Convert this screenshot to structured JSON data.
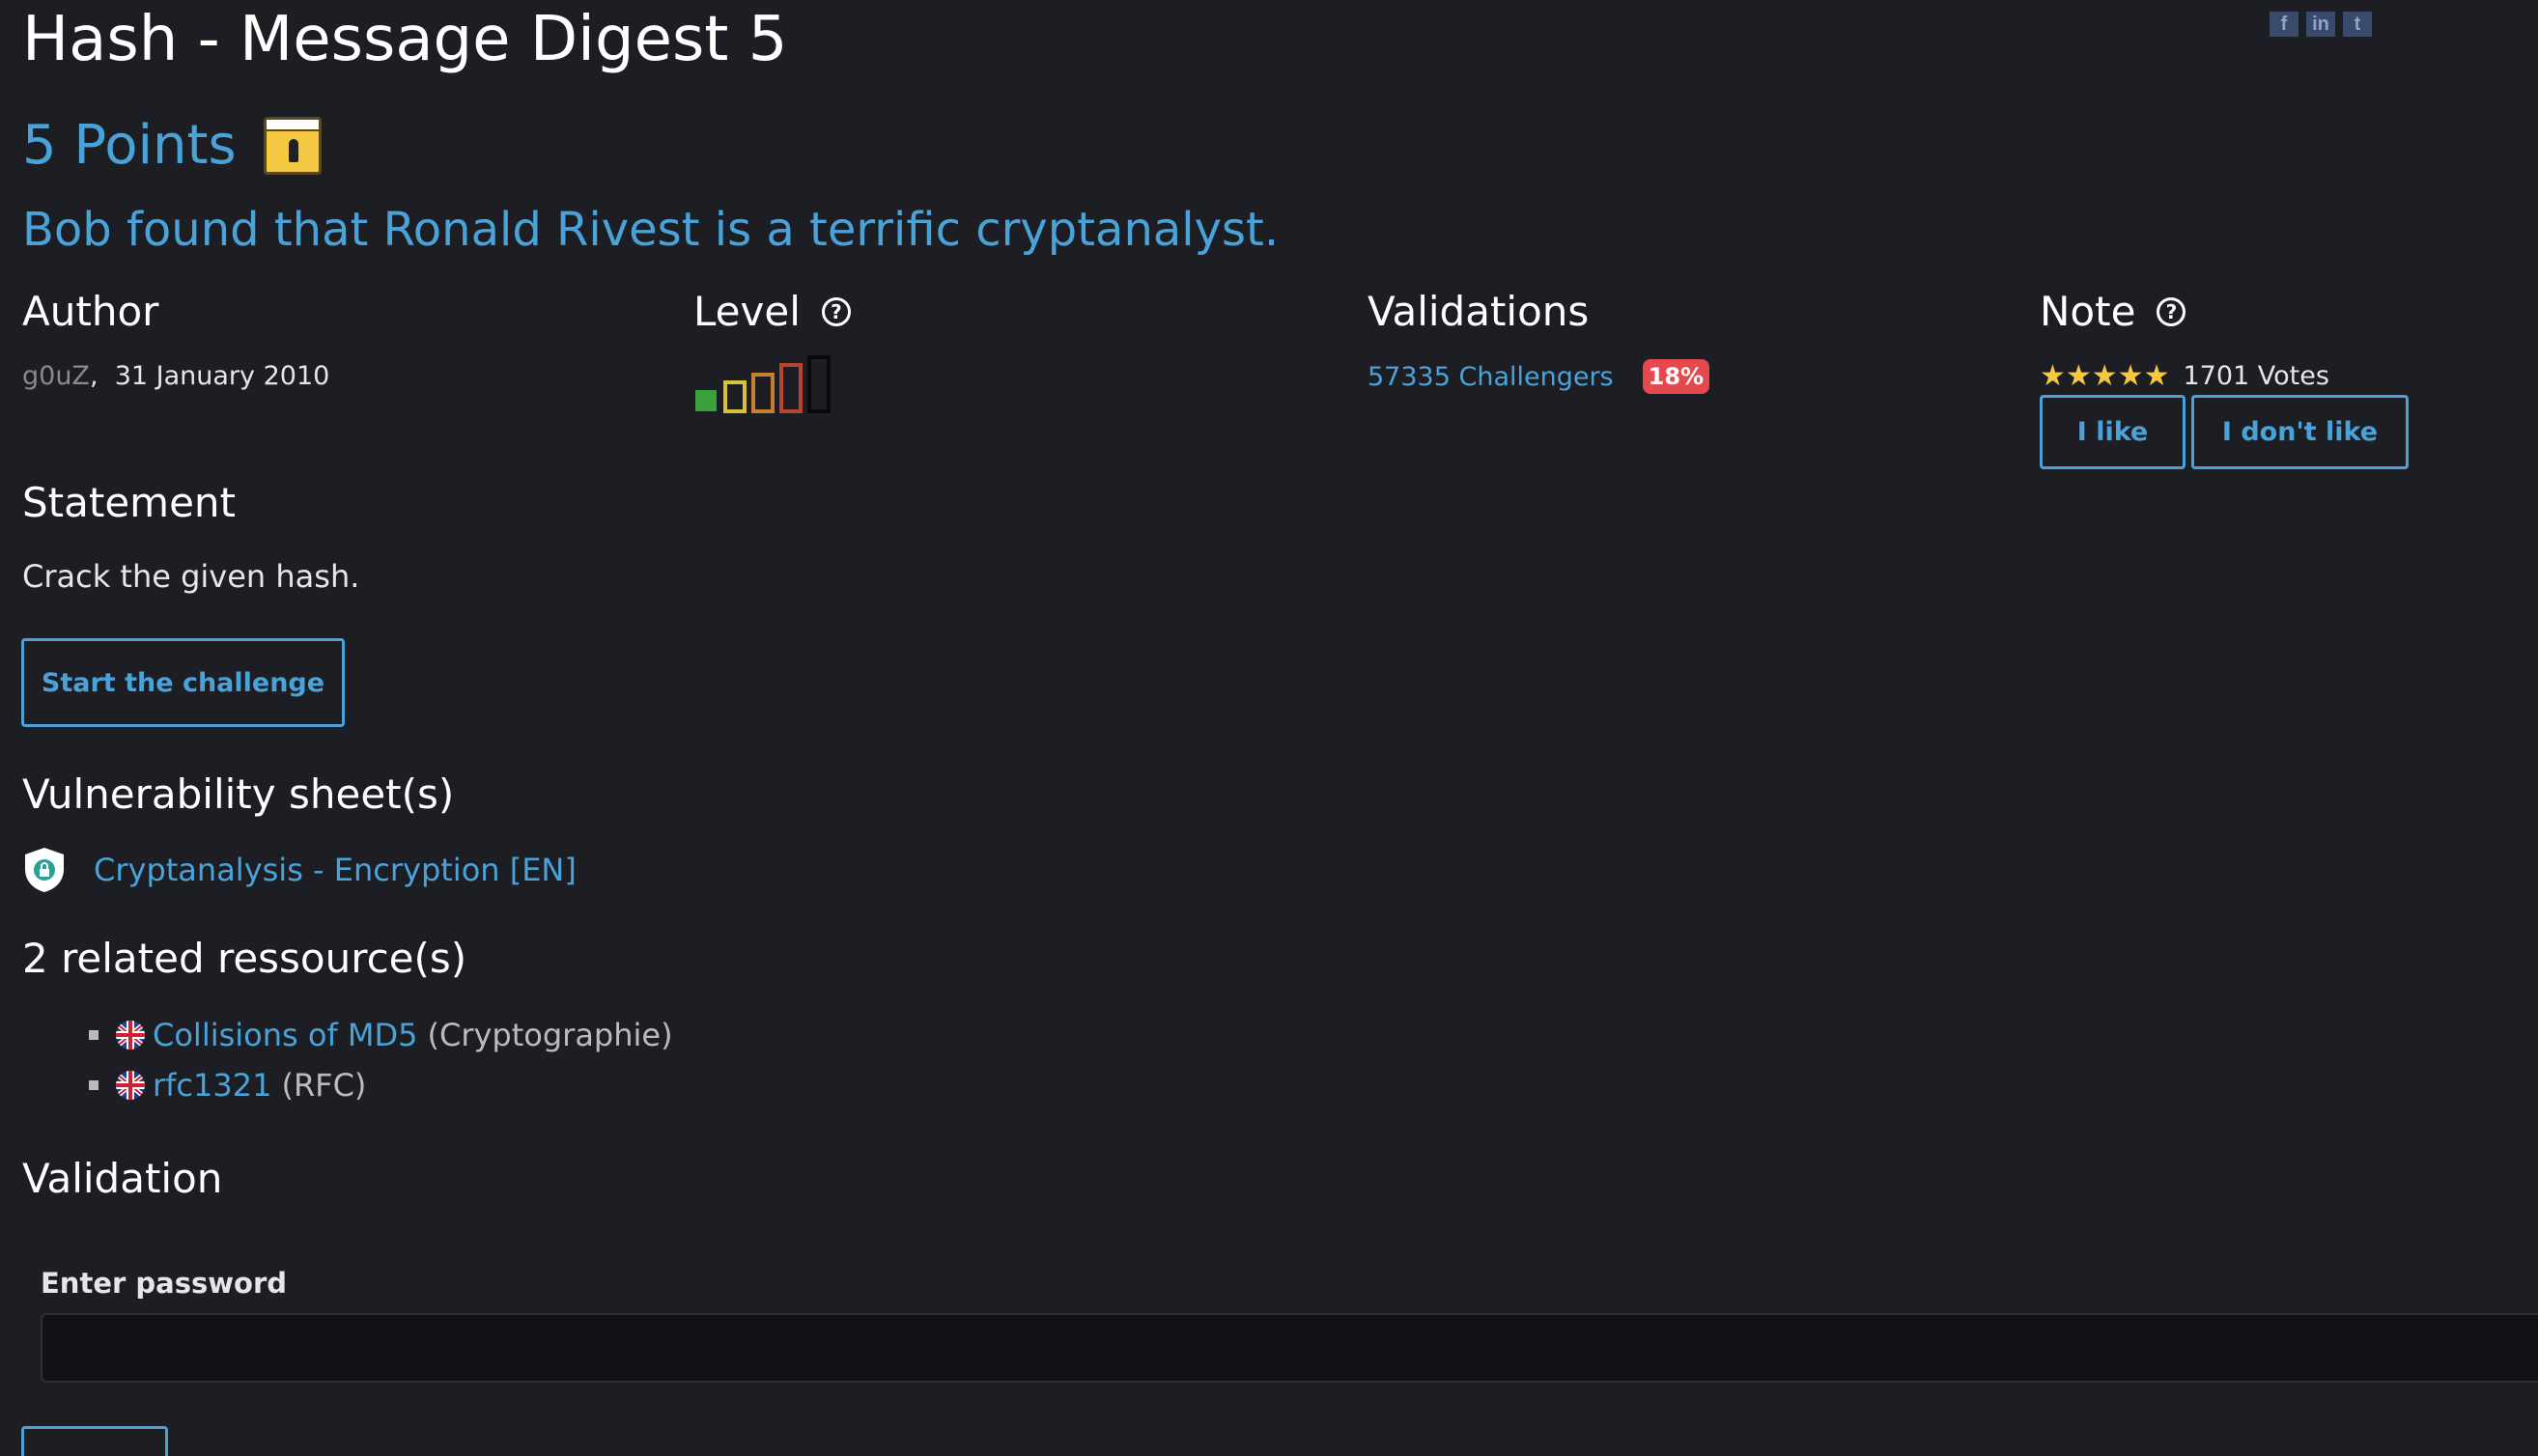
{
  "social": [
    {
      "name": "facebook-icon",
      "glyph": "f"
    },
    {
      "name": "linkedin-icon",
      "glyph": "in"
    },
    {
      "name": "twitter-icon",
      "glyph": "t"
    }
  ],
  "challenge": {
    "title": "Hash - Message Digest 5",
    "points": "5 Points",
    "subtitle": "Bob found that Ronald Rivest is a terrific cryptanalyst."
  },
  "author": {
    "heading": "Author",
    "name": "g0uZ",
    "separator": ",",
    "date": "31 January 2010"
  },
  "level": {
    "heading": "Level",
    "value": 1,
    "max": 5,
    "bar_colors": [
      "#3aa13a",
      "#d6c33a",
      "#c77f2f",
      "#b9432c",
      "#0a0a0a"
    ]
  },
  "validations": {
    "heading": "Validations",
    "challengers": "57335 Challengers",
    "percent": "18%"
  },
  "note": {
    "heading": "Note",
    "stars": "★★★★★",
    "votes": "1701 Votes",
    "like_label": "I like",
    "dislike_label": "I don't like"
  },
  "statement": {
    "heading": "Statement",
    "text": "Crack the given hash.",
    "start_label": "Start the challenge"
  },
  "vulnerability": {
    "heading": "Vulnerability sheet(s)",
    "items": [
      {
        "label": "Cryptanalysis - Encryption [EN]"
      }
    ]
  },
  "resources": {
    "heading": "2 related ressource(s)",
    "items": [
      {
        "title": "Collisions of MD5",
        "type": "(Cryptographie)"
      },
      {
        "title": "rfc1321",
        "type": "(RFC)"
      }
    ]
  },
  "validation": {
    "heading": "Validation",
    "label": "Enter password",
    "placeholder": ""
  },
  "colors": {
    "background": "#1c1e24",
    "accent": "#4aa3d8",
    "badge": "#e5484d",
    "star": "#f5c842"
  }
}
